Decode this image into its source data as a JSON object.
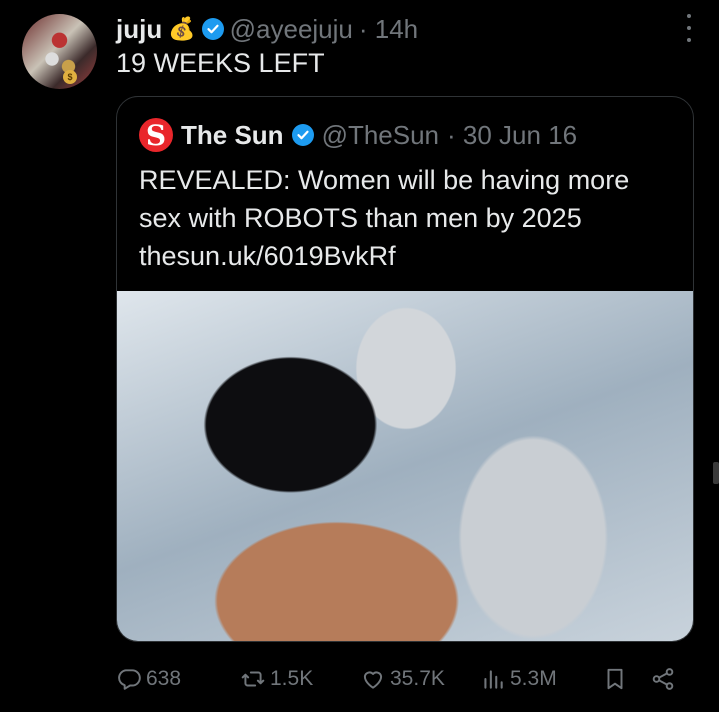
{
  "tweet": {
    "author": {
      "name": "juju",
      "name_emoji": "💰",
      "handle": "@ayeejuju",
      "time": "· 14h",
      "avatar": "user-avatar"
    },
    "text": "19 WEEKS LEFT",
    "quoted": {
      "logo_letter": "S",
      "name": "The Sun",
      "handle": "@TheSun",
      "time": "· 30 Jun 16",
      "text_line1": "REVEALED: Women will be having more",
      "text_line2": "sex with ROBOTS than men by 2025",
      "link": "thesun.uk/6019BvkRf",
      "image": "woman-sleeping-next-to-robot-photo"
    },
    "metrics": {
      "replies": "638",
      "retweets": "1.5K",
      "likes": "35.7K",
      "views": "5.3M"
    }
  },
  "colors": {
    "background": "#000000",
    "text": "#e7e9ea",
    "muted": "#71767b",
    "verified": "#1d9bf0",
    "sun_red": "#e9262b",
    "border": "#2f3336"
  },
  "icons": [
    "money-bag-icon",
    "verified-badge-icon",
    "more-options-icon",
    "reply-icon",
    "retweet-icon",
    "like-icon",
    "views-icon",
    "bookmark-icon",
    "share-icon"
  ]
}
